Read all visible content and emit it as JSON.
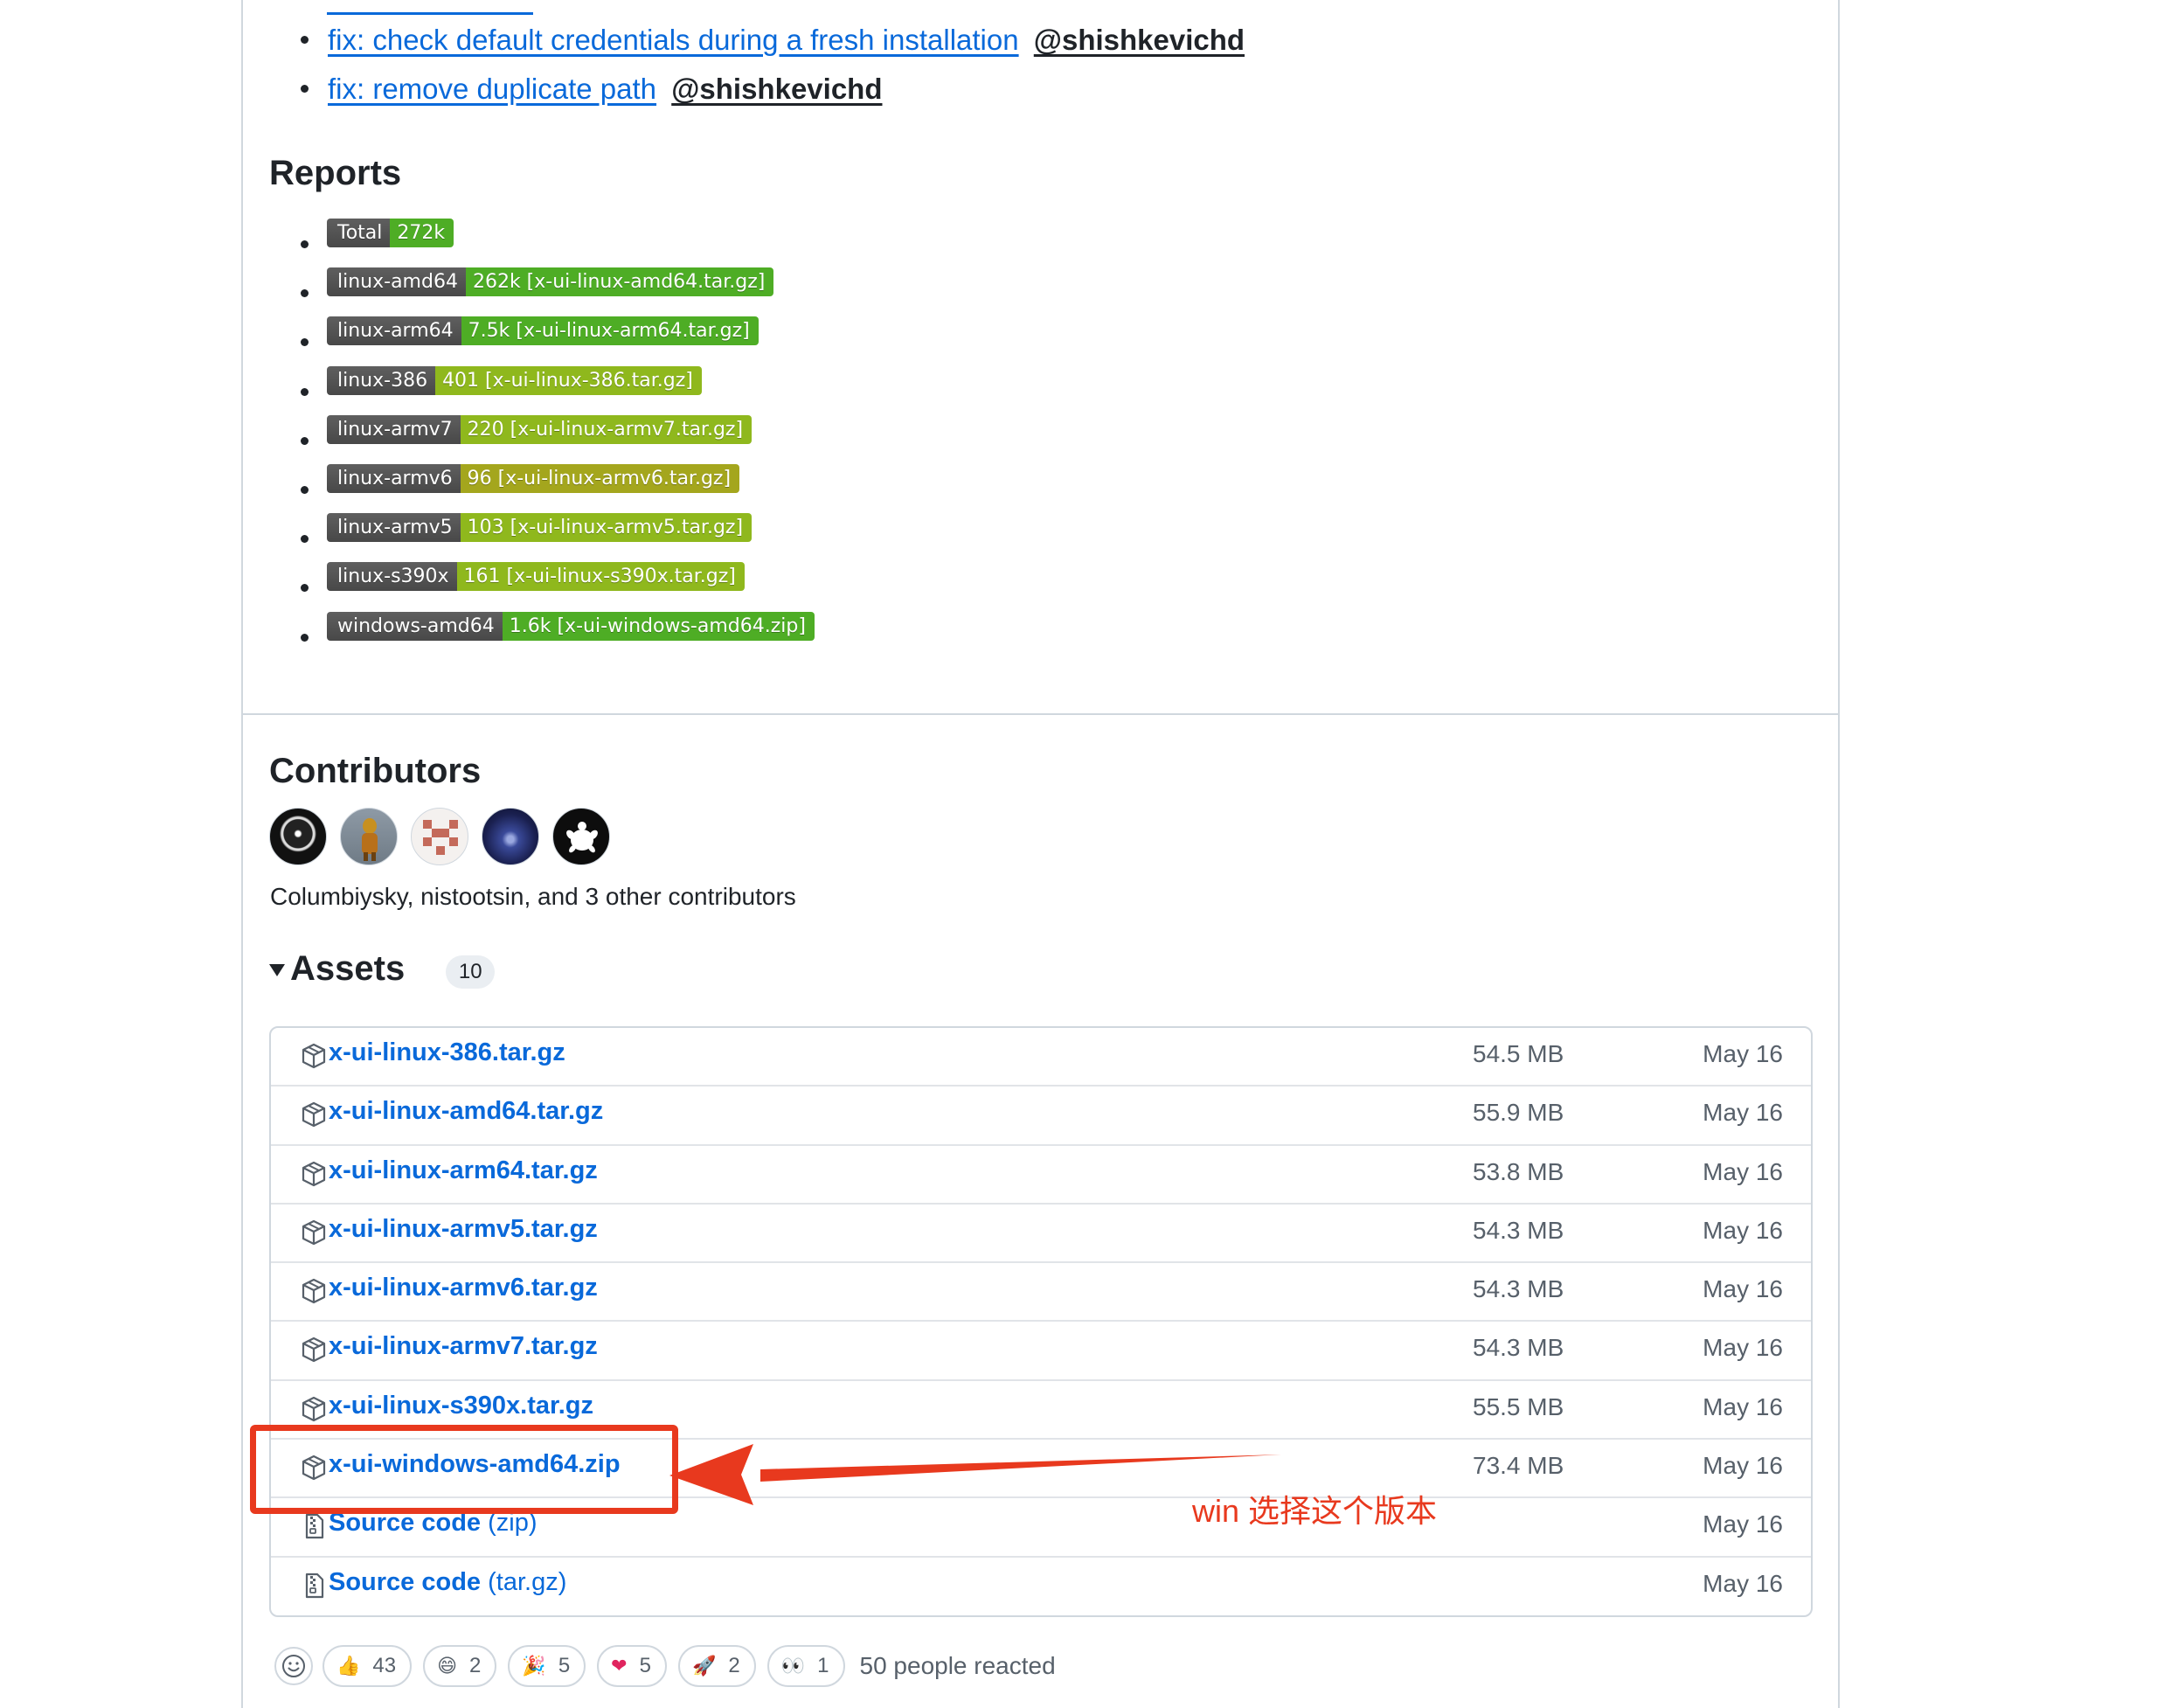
{
  "fixes": [
    {
      "link": "fix: check default credentials during a fresh installation",
      "user": "@shishkevichd"
    },
    {
      "link": "fix: remove duplicate path",
      "user": "@shishkevichd"
    }
  ],
  "reports": {
    "title": "Reports",
    "badges": [
      {
        "label": "Total",
        "value": "272k",
        "color": "#4ead25"
      },
      {
        "label": "linux-amd64",
        "value": "262k [x-ui-linux-amd64.tar.gz]",
        "color": "#4ead25"
      },
      {
        "label": "linux-arm64",
        "value": "7.5k [x-ui-linux-arm64.tar.gz]",
        "color": "#4ead25"
      },
      {
        "label": "linux-386",
        "value": "401 [x-ui-linux-386.tar.gz]",
        "color": "#8fb81d"
      },
      {
        "label": "linux-armv7",
        "value": "220 [x-ui-linux-armv7.tar.gz]",
        "color": "#8fb81d"
      },
      {
        "label": "linux-armv6",
        "value": "96 [x-ui-linux-armv6.tar.gz]",
        "color": "#a4a61d"
      },
      {
        "label": "linux-armv5",
        "value": "103 [x-ui-linux-armv5.tar.gz]",
        "color": "#8fb81d"
      },
      {
        "label": "linux-s390x",
        "value": "161 [x-ui-linux-s390x.tar.gz]",
        "color": "#8fb81d"
      },
      {
        "label": "windows-amd64",
        "value": "1.6k [x-ui-windows-amd64.zip]",
        "color": "#4ead25"
      }
    ]
  },
  "contributors": {
    "title": "Contributors",
    "summary": "Columbiysky, nistootsin, and 3 other contributors"
  },
  "assets": {
    "title": "Assets",
    "count": "10",
    "items": [
      {
        "name": "x-ui-linux-386.tar.gz",
        "suffix": "",
        "size": "54.5 MB",
        "date": "May 16",
        "icon": "package-icon"
      },
      {
        "name": "x-ui-linux-amd64.tar.gz",
        "suffix": "",
        "size": "55.9 MB",
        "date": "May 16",
        "icon": "package-icon"
      },
      {
        "name": "x-ui-linux-arm64.tar.gz",
        "suffix": "",
        "size": "53.8 MB",
        "date": "May 16",
        "icon": "package-icon"
      },
      {
        "name": "x-ui-linux-armv5.tar.gz",
        "suffix": "",
        "size": "54.3 MB",
        "date": "May 16",
        "icon": "package-icon"
      },
      {
        "name": "x-ui-linux-armv6.tar.gz",
        "suffix": "",
        "size": "54.3 MB",
        "date": "May 16",
        "icon": "package-icon"
      },
      {
        "name": "x-ui-linux-armv7.tar.gz",
        "suffix": "",
        "size": "54.3 MB",
        "date": "May 16",
        "icon": "package-icon"
      },
      {
        "name": "x-ui-linux-s390x.tar.gz",
        "suffix": "",
        "size": "55.5 MB",
        "date": "May 16",
        "icon": "package-icon"
      },
      {
        "name": "x-ui-windows-amd64.zip",
        "suffix": "",
        "size": "73.4 MB",
        "date": "May 16",
        "icon": "package-icon"
      },
      {
        "name": "Source code",
        "suffix": " (zip)",
        "size": "",
        "date": "May 16",
        "icon": "file-zip-icon"
      },
      {
        "name": "Source code",
        "suffix": " (tar.gz)",
        "size": "",
        "date": "May 16",
        "icon": "file-zip-icon"
      }
    ]
  },
  "annotation": {
    "text": "win 选择这个版本",
    "color": "#e8391e"
  },
  "reactions": {
    "items": [
      {
        "emoji": "👍",
        "icon": "thumbs-up-icon",
        "count": "43"
      },
      {
        "emoji": "😄",
        "icon": "laugh-icon",
        "count": "2"
      },
      {
        "emoji": "🎉",
        "icon": "hooray-icon",
        "count": "5"
      },
      {
        "emoji": "❤",
        "icon": "heart-icon",
        "count": "5"
      },
      {
        "emoji": "🚀",
        "icon": "rocket-icon",
        "count": "2"
      },
      {
        "emoji": "👀",
        "icon": "eyes-icon",
        "count": "1"
      }
    ],
    "summary": "50 people reacted"
  }
}
